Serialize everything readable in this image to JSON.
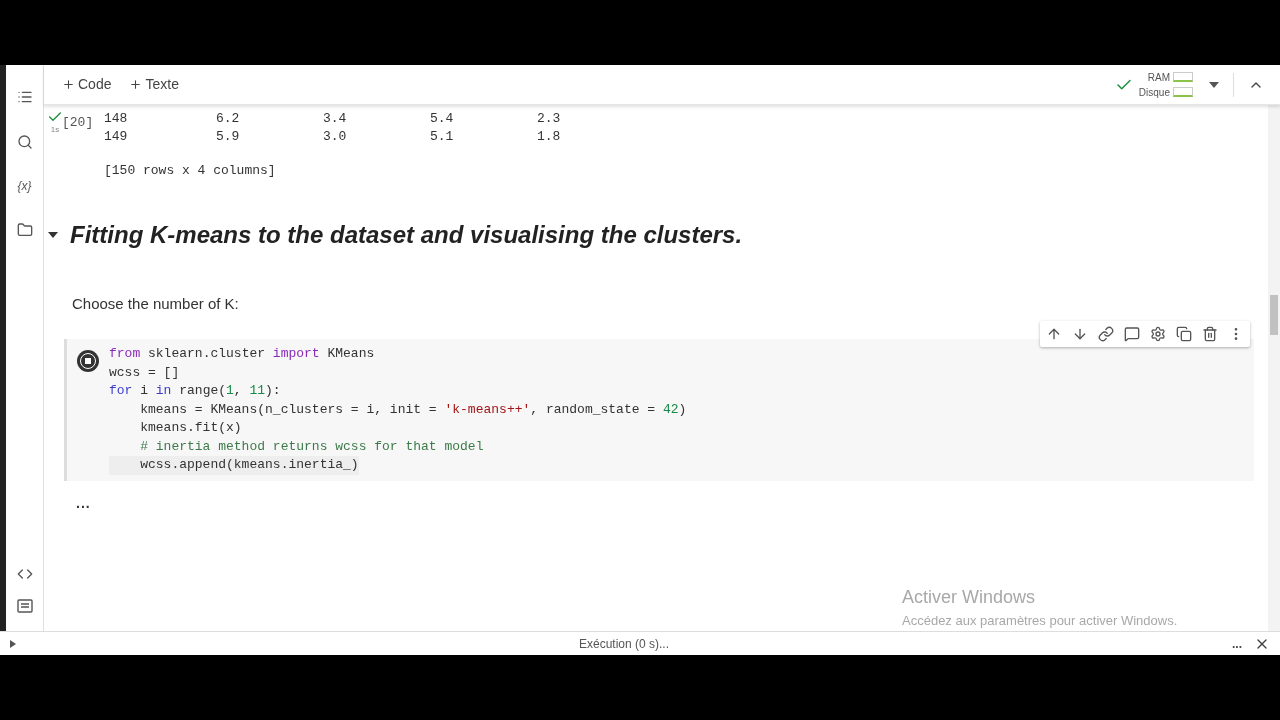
{
  "toolbar": {
    "add_buttons": [
      "Code",
      "Texte"
    ],
    "resources": [
      "RAM",
      "Disque"
    ],
    "connected": true
  },
  "sidebar": {
    "variables_label": "{x}"
  },
  "output_cell": {
    "done": true,
    "count": "[20]",
    "time": "1s",
    "rows": [
      [
        "148",
        "6.2",
        "3.4",
        "5.4",
        "2.3"
      ],
      [
        "149",
        "5.9",
        "3.0",
        "5.1",
        "1.8"
      ]
    ],
    "summary": "[150 rows x 4 columns]"
  },
  "section": {
    "title": "Fitting K-means to the dataset and visualising the clusters.",
    "expanded": true
  },
  "paragraph": "Choose the number of K:",
  "code_cell": {
    "running": true,
    "lines": [
      [
        {
          "kind": "keyword",
          "text": "from"
        },
        {
          "kind": "plain",
          "text": " sklearn.cluster "
        },
        {
          "kind": "keyword",
          "text": "import"
        },
        {
          "kind": "plain",
          "text": " KMeans"
        }
      ],
      [
        {
          "kind": "plain",
          "text": "wcss = []"
        }
      ],
      [
        {
          "kind": "control",
          "text": "for"
        },
        {
          "kind": "plain",
          "text": " i "
        },
        {
          "kind": "control",
          "text": "in"
        },
        {
          "kind": "plain",
          "text": " range("
        },
        {
          "kind": "number",
          "text": "1"
        },
        {
          "kind": "plain",
          "text": ", "
        },
        {
          "kind": "number",
          "text": "11"
        },
        {
          "kind": "plain",
          "text": "):"
        }
      ],
      [
        {
          "kind": "plain",
          "text": "    kmeans = KMeans(n_clusters = i, init = "
        },
        {
          "kind": "string",
          "text": "'k-means++'"
        },
        {
          "kind": "plain",
          "text": ", random_state = "
        },
        {
          "kind": "number",
          "text": "42"
        },
        {
          "kind": "plain",
          "text": ")"
        }
      ],
      [
        {
          "kind": "plain",
          "text": "    kmeans.fit(x)"
        }
      ],
      [
        {
          "kind": "comment",
          "text": "    # inertia method returns wcss for that model"
        }
      ],
      [
        {
          "kind": "plain",
          "text": "    wcss.append(kmeans.inertia_)"
        }
      ]
    ],
    "output": "..."
  },
  "activation": {
    "title": "Activer Windows",
    "subtitle": "Accédez aux paramètres pour activer Windows."
  },
  "status_bar": {
    "text": "Exécution (0 s)...",
    "more": "..."
  }
}
